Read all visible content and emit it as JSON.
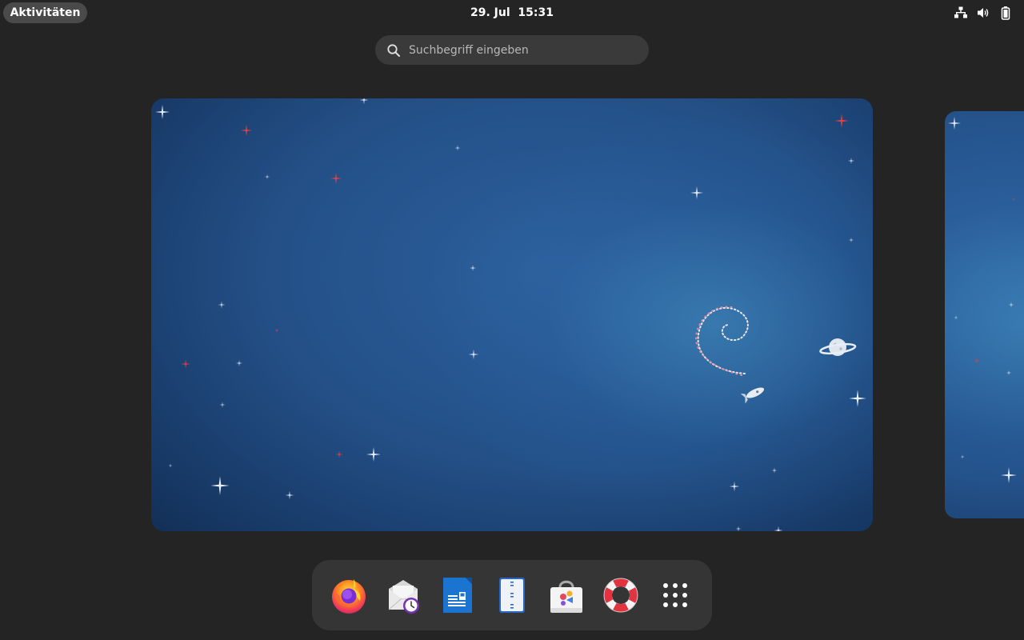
{
  "topbar": {
    "activities_label": "Aktivitäten",
    "clock_date": "29. Jul",
    "clock_time": "15:31",
    "tray_icons": [
      "network-wired-icon",
      "volume-icon",
      "battery-icon"
    ]
  },
  "search": {
    "placeholder": "Suchbegriff eingeben",
    "value": ""
  },
  "workspaces": {
    "wallpaper": "debian-space-stars",
    "colors": {
      "sky_center": "#2c5f9c",
      "sky_edge": "#07162c",
      "glow": "#4696c8"
    }
  },
  "dash": {
    "apps": [
      {
        "name": "firefox",
        "icon": "firefox-icon"
      },
      {
        "name": "evolution",
        "icon": "mail-clock-icon"
      },
      {
        "name": "libreoffice-writer",
        "icon": "writer-document-icon"
      },
      {
        "name": "file-roller",
        "icon": "archive-icon"
      },
      {
        "name": "software",
        "icon": "software-bag-icon"
      },
      {
        "name": "help",
        "icon": "help-lifebuoy-icon"
      },
      {
        "name": "show-apps",
        "icon": "app-grid-icon"
      }
    ]
  }
}
